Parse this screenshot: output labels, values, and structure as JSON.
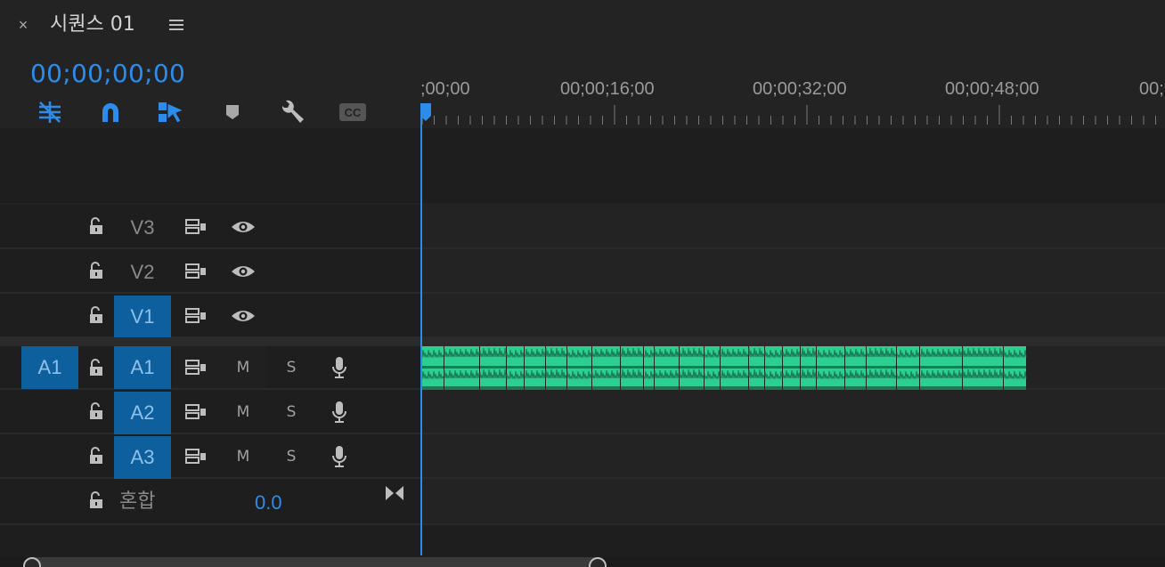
{
  "panel": {
    "close_label": "×",
    "title": "시퀀스 01",
    "timecode": "00;00;00;00"
  },
  "toolbar": {
    "tools": [
      {
        "name": "insert-nested-sequence-icon",
        "active": true
      },
      {
        "name": "snap-magnet-icon",
        "active": true
      },
      {
        "name": "linked-selection-icon",
        "active": true
      },
      {
        "name": "add-marker-icon",
        "active": false
      },
      {
        "name": "timeline-settings-wrench-icon",
        "active": false
      },
      {
        "name": "captions-cc-icon",
        "active": false
      }
    ]
  },
  "ruler": {
    "labels": [
      ";00;00",
      "00;00;16;00",
      "00;00;32;00",
      "00;00;48;00",
      "00;"
    ]
  },
  "video_tracks": [
    {
      "label": "V3",
      "targeted": false
    },
    {
      "label": "V2",
      "targeted": false
    },
    {
      "label": "V1",
      "targeted": true
    }
  ],
  "audio_tracks": [
    {
      "source": "A1",
      "label": "A1",
      "targeted": true,
      "mute": "M",
      "solo": "S"
    },
    {
      "label": "A2",
      "targeted": true,
      "mute": "M",
      "solo": "S"
    },
    {
      "label": "A3",
      "targeted": true,
      "mute": "M",
      "solo": "S"
    }
  ],
  "mix": {
    "label": "혼합",
    "value": "0.0"
  },
  "colors": {
    "accent": "#2d8ceb",
    "track_target": "#0e5f9e",
    "audio_clip": "#2bd091",
    "audio_clip_dark": "#1a7a55"
  }
}
